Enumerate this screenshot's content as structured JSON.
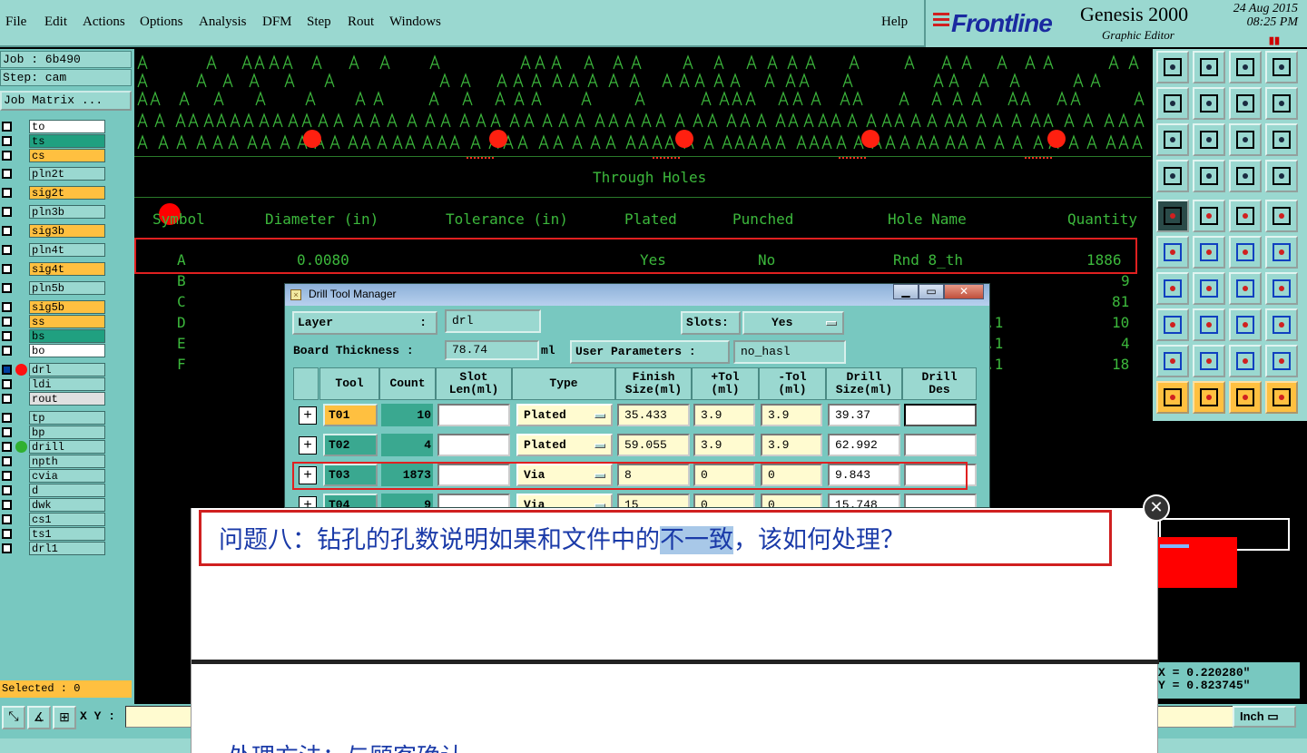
{
  "menubar": {
    "items": [
      "File",
      "Edit",
      "Actions",
      "Options",
      "Analysis",
      "DFM",
      "Step",
      "Rout",
      "Windows"
    ],
    "help": "Help"
  },
  "brand": {
    "logo": "Frontline",
    "product": "Genesis 2000",
    "subtitle": "Graphic Editor",
    "date": "24 Aug 2015",
    "time": "08:25 PM"
  },
  "left": {
    "job": "Job : 6b490",
    "step": "Step: cam",
    "job_matrix": "Job Matrix ...",
    "selected": "Selected : 0",
    "layers": [
      {
        "name": "to",
        "color": "#ffffff"
      },
      {
        "name": "ts",
        "color": "#20a080"
      },
      {
        "name": "cs",
        "color": "#ffc040"
      },
      {
        "name": "pln2t",
        "color": "#9ad8d0"
      },
      {
        "name": "sig2t",
        "color": "#ffc040"
      },
      {
        "name": "pln3b",
        "color": "#9ad8d0"
      },
      {
        "name": "sig3b",
        "color": "#ffc040"
      },
      {
        "name": "pln4t",
        "color": "#9ad8d0"
      },
      {
        "name": "sig4t",
        "color": "#ffc040"
      },
      {
        "name": "pln5b",
        "color": "#9ad8d0"
      },
      {
        "name": "sig5b",
        "color": "#ffc040"
      },
      {
        "name": "ss",
        "color": "#ffc040"
      },
      {
        "name": "bs",
        "color": "#20a080"
      },
      {
        "name": "bo",
        "color": "#ffffff"
      },
      {
        "name": "drl",
        "color": "#9ad8d0"
      },
      {
        "name": "ldi",
        "color": "#9ad8d0"
      },
      {
        "name": "rout",
        "color": "#e0e0e0"
      },
      {
        "name": "tp",
        "color": "#9ad8d0"
      },
      {
        "name": "bp",
        "color": "#9ad8d0"
      },
      {
        "name": "drill",
        "color": "#9ad8d0"
      },
      {
        "name": "npth",
        "color": "#9ad8d0"
      },
      {
        "name": "cvia",
        "color": "#9ad8d0"
      },
      {
        "name": "d",
        "color": "#9ad8d0"
      },
      {
        "name": "dwk",
        "color": "#9ad8d0"
      },
      {
        "name": "cs1",
        "color": "#9ad8d0"
      },
      {
        "name": "ts1",
        "color": "#9ad8d0"
      },
      {
        "name": "drl1",
        "color": "#9ad8d0"
      }
    ]
  },
  "graphic": {
    "section_title": "Through Holes",
    "headers": {
      "symbol": "Symbol",
      "diameter": "Diameter (in)",
      "tolerance": "Tolerance (in)",
      "plated": "Plated",
      "punched": "Punched",
      "hole_name": "Hole Name",
      "quantity": "Quantity"
    },
    "row_a": {
      "symbol": "A",
      "diameter": "0.0080",
      "plated": "Yes",
      "punched": "No",
      "hole_name": "Rnd 8_th",
      "quantity": "1886"
    },
    "partial_rows": [
      {
        "symbol": "B",
        "suffix": "",
        "quantity": "9"
      },
      {
        "symbol": "C",
        "suffix": "",
        "quantity": "81"
      },
      {
        "symbol": "D",
        "suffix": ".1",
        "quantity": "10"
      },
      {
        "symbol": "E",
        "suffix": ".1",
        "quantity": "4"
      },
      {
        "symbol": "F",
        "suffix": ".1",
        "quantity": "18"
      }
    ]
  },
  "coords": {
    "x": "X = 0.220280\"",
    "y": "Y = 0.823745\""
  },
  "bottom": {
    "xy_label": "X Y :",
    "unit": "Inch"
  },
  "dialog": {
    "title": "Drill Tool Manager",
    "layer_label": "Layer",
    "layer_sep": ":",
    "layer_value": "drl",
    "slots_label": "Slots:",
    "slots_value": "Yes",
    "board_thickness_label": "Board Thickness :",
    "board_thickness_value": "78.74",
    "board_thickness_unit": "ml",
    "user_params_label": "User Parameters :",
    "user_params_value": "no_hasl",
    "columns": {
      "tool": "Tool",
      "count": "Count",
      "slot": "Slot\nLen(ml)",
      "type": "Type",
      "finish": "Finish\nSize(ml)",
      "ptol": "+Tol\n(ml)",
      "ntol": "-Tol\n(ml)",
      "drill": "Drill\nSize(ml)",
      "des": "Drill\nDes"
    },
    "rows": [
      {
        "tool": "T01",
        "count": "10",
        "type": "Plated",
        "finish": "35.433",
        "ptol": "3.9",
        "ntol": "3.9",
        "drill": "39.37"
      },
      {
        "tool": "T02",
        "count": "4",
        "type": "Plated",
        "finish": "59.055",
        "ptol": "3.9",
        "ntol": "3.9",
        "drill": "62.992"
      },
      {
        "tool": "T03",
        "count": "1873",
        "type": "Via",
        "finish": "8",
        "ptol": "0",
        "ntol": "0",
        "drill": "9.843"
      },
      {
        "tool": "T04",
        "count": "9",
        "type": "Via",
        "finish": "15",
        "ptol": "0",
        "ntol": "0",
        "drill": "15.748"
      }
    ]
  },
  "overlay": {
    "question_pre": "问题八：钻孔的孔数说明如果和文件中的",
    "question_hl": "不一致",
    "question_post": "，该如何处理？",
    "answer_start": "处理方法：与顾客确认"
  },
  "colors": {
    "accent_red": "#e02020",
    "panel": "#78c8c0",
    "green_text": "#3cb83c"
  }
}
